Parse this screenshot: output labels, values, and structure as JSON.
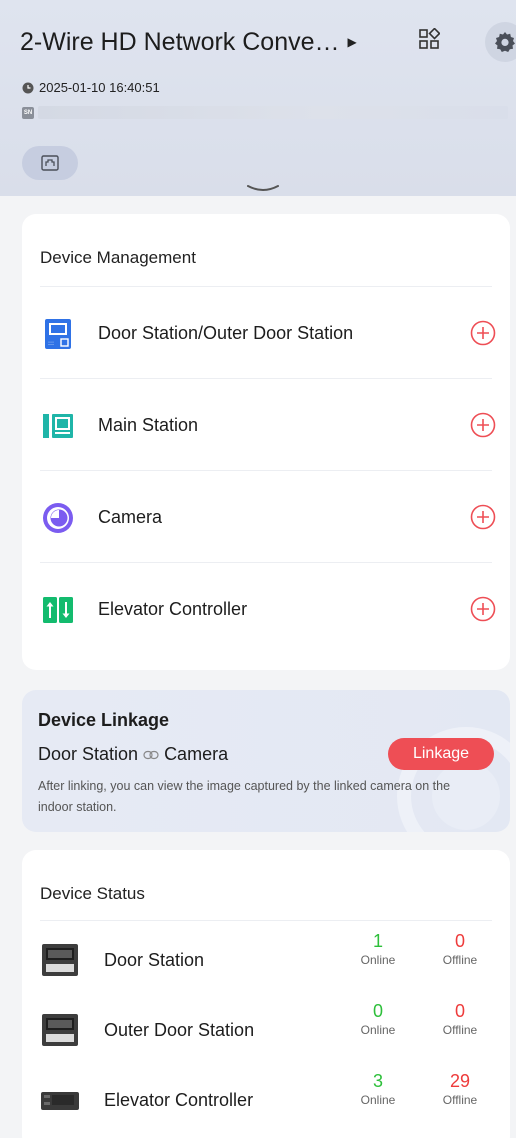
{
  "header": {
    "title": "2-Wire HD Network Conve…",
    "timestamp": "2025-01-10 16:40:51",
    "sn_badge": "SN"
  },
  "device_management": {
    "title": "Device Management",
    "items": [
      {
        "label": "Door Station/Outer Door Station",
        "icon": "door-station-icon"
      },
      {
        "label": "Main Station",
        "icon": "main-station-icon"
      },
      {
        "label": "Camera",
        "icon": "camera-icon"
      },
      {
        "label": "Elevator Controller",
        "icon": "elevator-controller-icon"
      }
    ]
  },
  "linkage": {
    "title": "Device Linkage",
    "from": "Door Station",
    "to": "Camera",
    "button": "Linkage",
    "description": "After linking, you can view the image captured by the linked camera on the indoor station."
  },
  "device_status": {
    "title": "Device Status",
    "online_label": "Online",
    "offline_label": "Offline",
    "rows": [
      {
        "label": "Door Station",
        "online": "1",
        "offline": "0"
      },
      {
        "label": "Outer Door Station",
        "online": "0",
        "offline": "0"
      },
      {
        "label": "Elevator Controller",
        "online": "3",
        "offline": "29"
      }
    ]
  },
  "colors": {
    "accent_red": "#ee4e55",
    "online_green": "#2dbf3a",
    "offline_red": "#ee3b3b",
    "header_bg": "#dfe4ef"
  }
}
